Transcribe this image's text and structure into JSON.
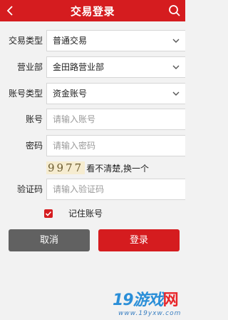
{
  "header": {
    "title": "交易登录",
    "back_icon": "chevron-left-icon",
    "search_icon": "search-icon"
  },
  "form": {
    "trade_type": {
      "label": "交易类型",
      "value": "普通交易"
    },
    "branch": {
      "label": "营业部",
      "value": "金田路营业部"
    },
    "account_type": {
      "label": "账号类型",
      "value": "资金账号"
    },
    "account": {
      "label": "账号",
      "placeholder": "请输入账号"
    },
    "password": {
      "label": "密码",
      "placeholder": "请输入密码"
    },
    "captcha_image": {
      "code": "9977",
      "refresh_text": "看不清楚,换一个"
    },
    "captcha": {
      "label": "验证码",
      "placeholder": "请输入验证码"
    },
    "remember": {
      "label": "记住账号",
      "checked": true
    }
  },
  "buttons": {
    "cancel": "取消",
    "login": "登录"
  },
  "watermark": {
    "brand_num": "19",
    "brand_text": "游戏",
    "brand_suffix": "网",
    "url": "www.19yxw.com"
  },
  "colors": {
    "primary": "#d51c1f",
    "cancel": "#616161",
    "background": "#f2f2f2"
  }
}
